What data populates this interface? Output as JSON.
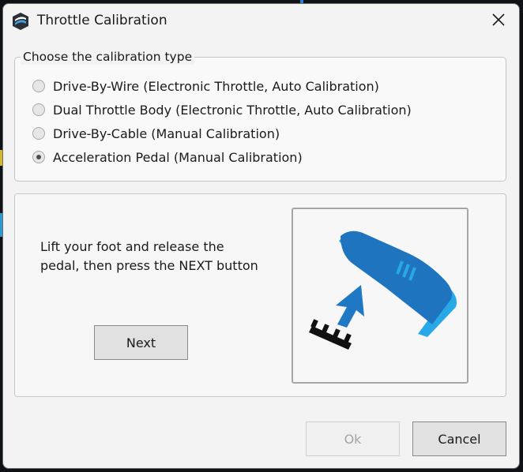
{
  "window": {
    "title": "Throttle Calibration",
    "app_icon": "app-logo-icon",
    "close_icon": "close-icon"
  },
  "calibration_type": {
    "legend": "Choose the calibration type",
    "options": [
      {
        "label": "Drive-By-Wire (Electronic Throttle, Auto Calibration)",
        "checked": false
      },
      {
        "label": "Dual Throttle Body (Electronic Throttle, Auto Calibration)",
        "checked": false
      },
      {
        "label": "Drive-By-Cable (Manual Calibration)",
        "checked": false
      },
      {
        "label": "Acceleration Pedal (Manual Calibration)",
        "checked": true
      }
    ]
  },
  "step_panel": {
    "instruction_line1": "Lift your foot and release the",
    "instruction_line2": "pedal, then press the NEXT button",
    "next_label": "Next",
    "illustration": "foot-lifting-off-pedal-icon"
  },
  "footer": {
    "ok_label": "Ok",
    "ok_enabled": false,
    "cancel_label": "Cancel"
  },
  "colors": {
    "shoe_dark": "#1e74be",
    "shoe_light": "#29a8e8",
    "arrow": "#1f78c4",
    "pedal": "#111111"
  }
}
